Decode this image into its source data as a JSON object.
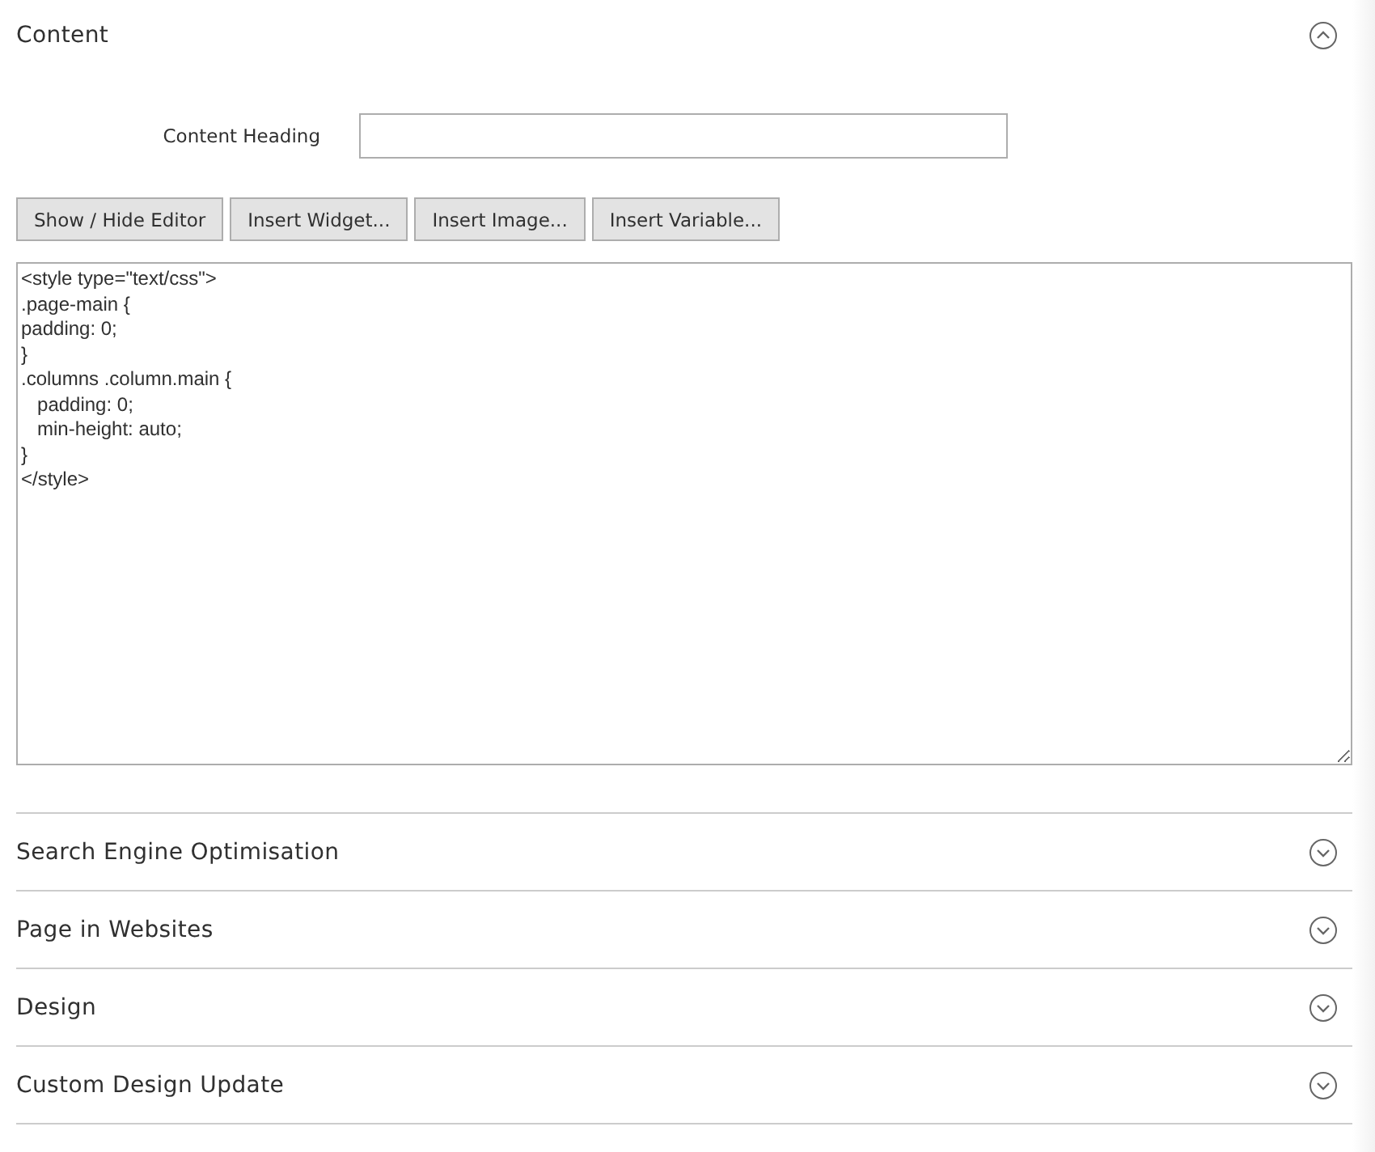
{
  "content_section": {
    "title": "Content",
    "expanded": true,
    "field": {
      "label": "Content Heading"
    },
    "buttons": [
      "Show / Hide Editor",
      "Insert Widget...",
      "Insert Image...",
      "Insert Variable..."
    ],
    "editor": {
      "value": "<style type=\"text/css\">\n.page-main {\npadding: 0;\n}\n.columns .column.main {\n   padding: 0;\n   min-height: auto;\n}\n</style>"
    }
  },
  "sections": [
    {
      "title": "Search Engine Optimisation",
      "expanded": false
    },
    {
      "title": "Page in Websites",
      "expanded": false
    },
    {
      "title": "Design",
      "expanded": false
    },
    {
      "title": "Custom Design Update",
      "expanded": false
    }
  ]
}
